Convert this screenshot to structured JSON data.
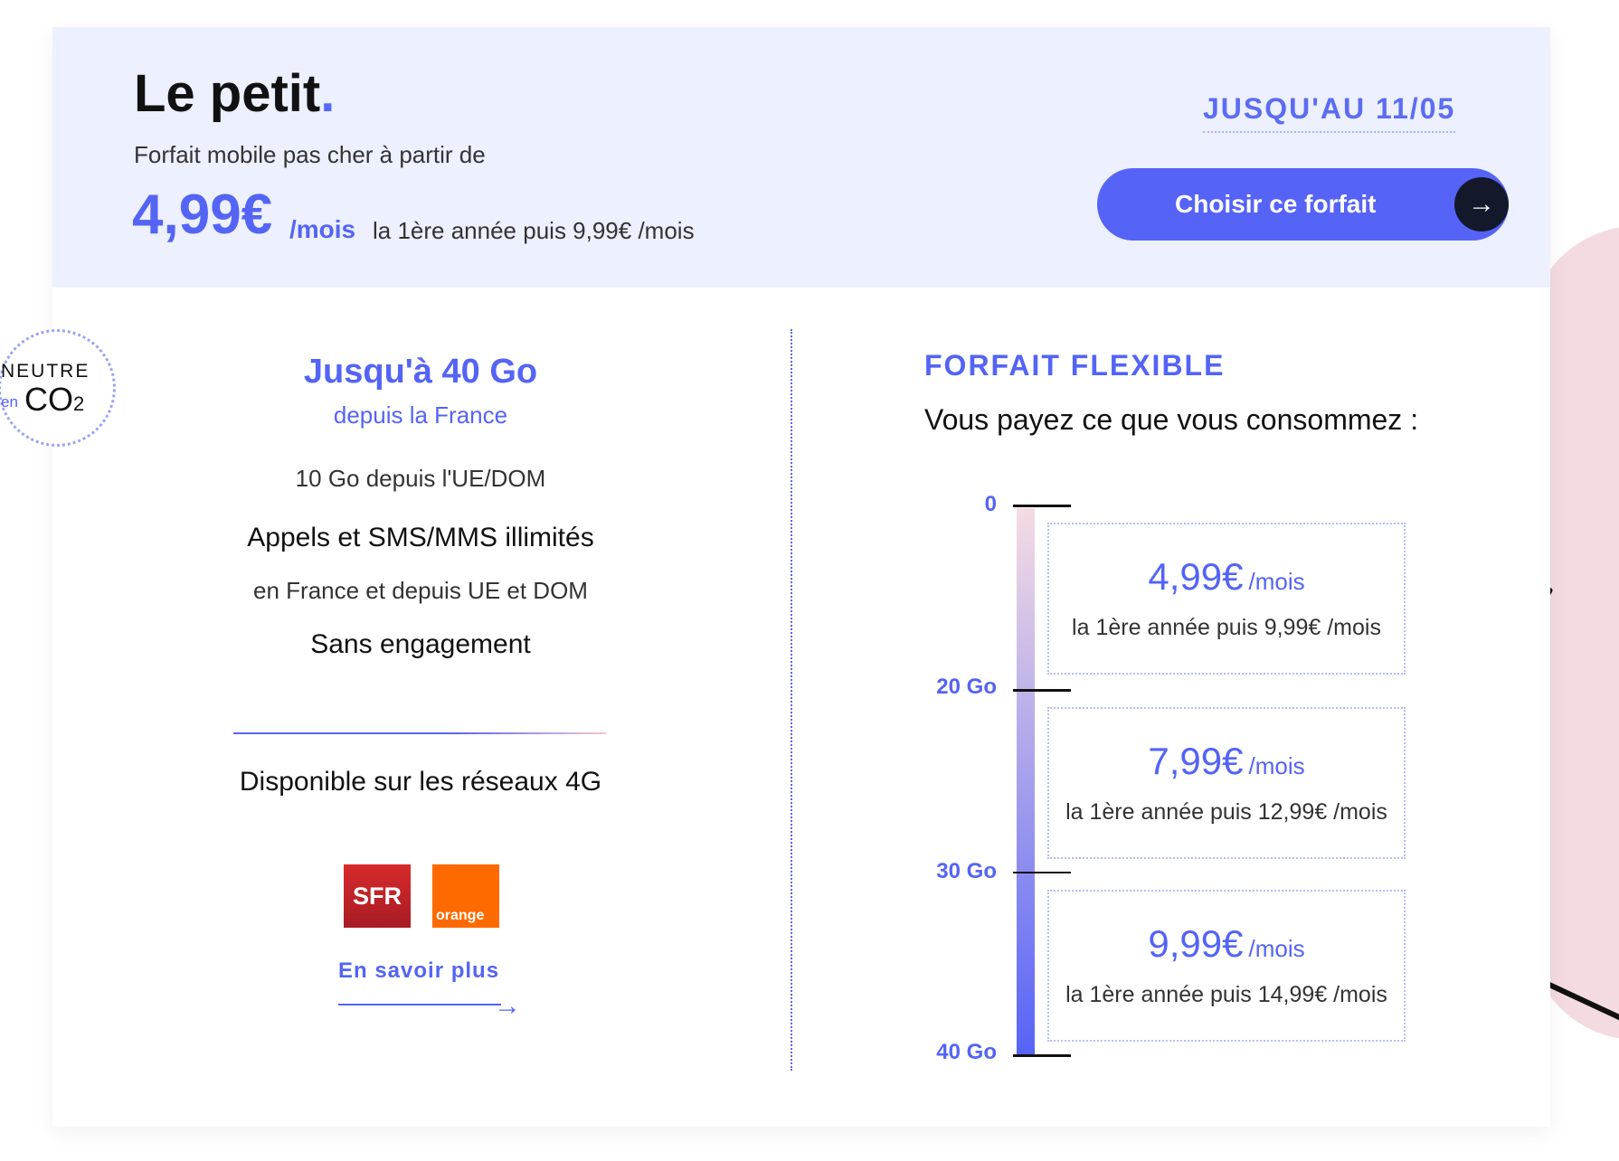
{
  "header": {
    "title": "Le petit",
    "title_dot": ".",
    "subtitle": "Forfait mobile pas cher à partir de",
    "price": "4,99€",
    "price_unit": "/mois",
    "price_after": "la 1ère année puis 9,99€ /mois",
    "promo": "JUSQU'AU 11/05",
    "cta_label": "Choisir ce forfait",
    "cta_icon": "arrow-right-icon"
  },
  "badge": {
    "line1": "NEUTRE",
    "line2": "en",
    "line3": "CO",
    "line3_sub": "2"
  },
  "features": {
    "data_title": "Jusqu'à 40 Go",
    "data_sub": "depuis la France",
    "eu_data": "10 Go depuis l'UE/DOM",
    "calls_title": "Appels et SMS/MMS illimités",
    "calls_sub": "en France et depuis UE et DOM",
    "commitment": "Sans engagement",
    "networks_title": "Disponible sur les réseaux 4G",
    "sfr_label": "SFR",
    "orange_label": "orange",
    "learn_more": "En savoir plus",
    "learn_more_icon": "arrow-right-icon"
  },
  "flexible": {
    "title": "FORFAIT FLEXIBLE",
    "subtitle": "Vous payez ce que vous consommez :",
    "ticks": [
      "0",
      "20 Go",
      "30 Go",
      "40 Go"
    ],
    "tiers": [
      {
        "price": "4,99€",
        "unit": "/mois",
        "after": "la 1ère année puis 9,99€ /mois"
      },
      {
        "price": "7,99€",
        "unit": "/mois",
        "after": "la 1ère année puis 12,99€ /mois"
      },
      {
        "price": "9,99€",
        "unit": "/mois",
        "after": "la 1ère année puis 14,99€ /mois"
      }
    ]
  },
  "colors": {
    "accent": "#5464f5",
    "header_bg": "#ecf0ff",
    "cta_bg": "#5663f7",
    "pink_deco": "#f3dbe1"
  }
}
